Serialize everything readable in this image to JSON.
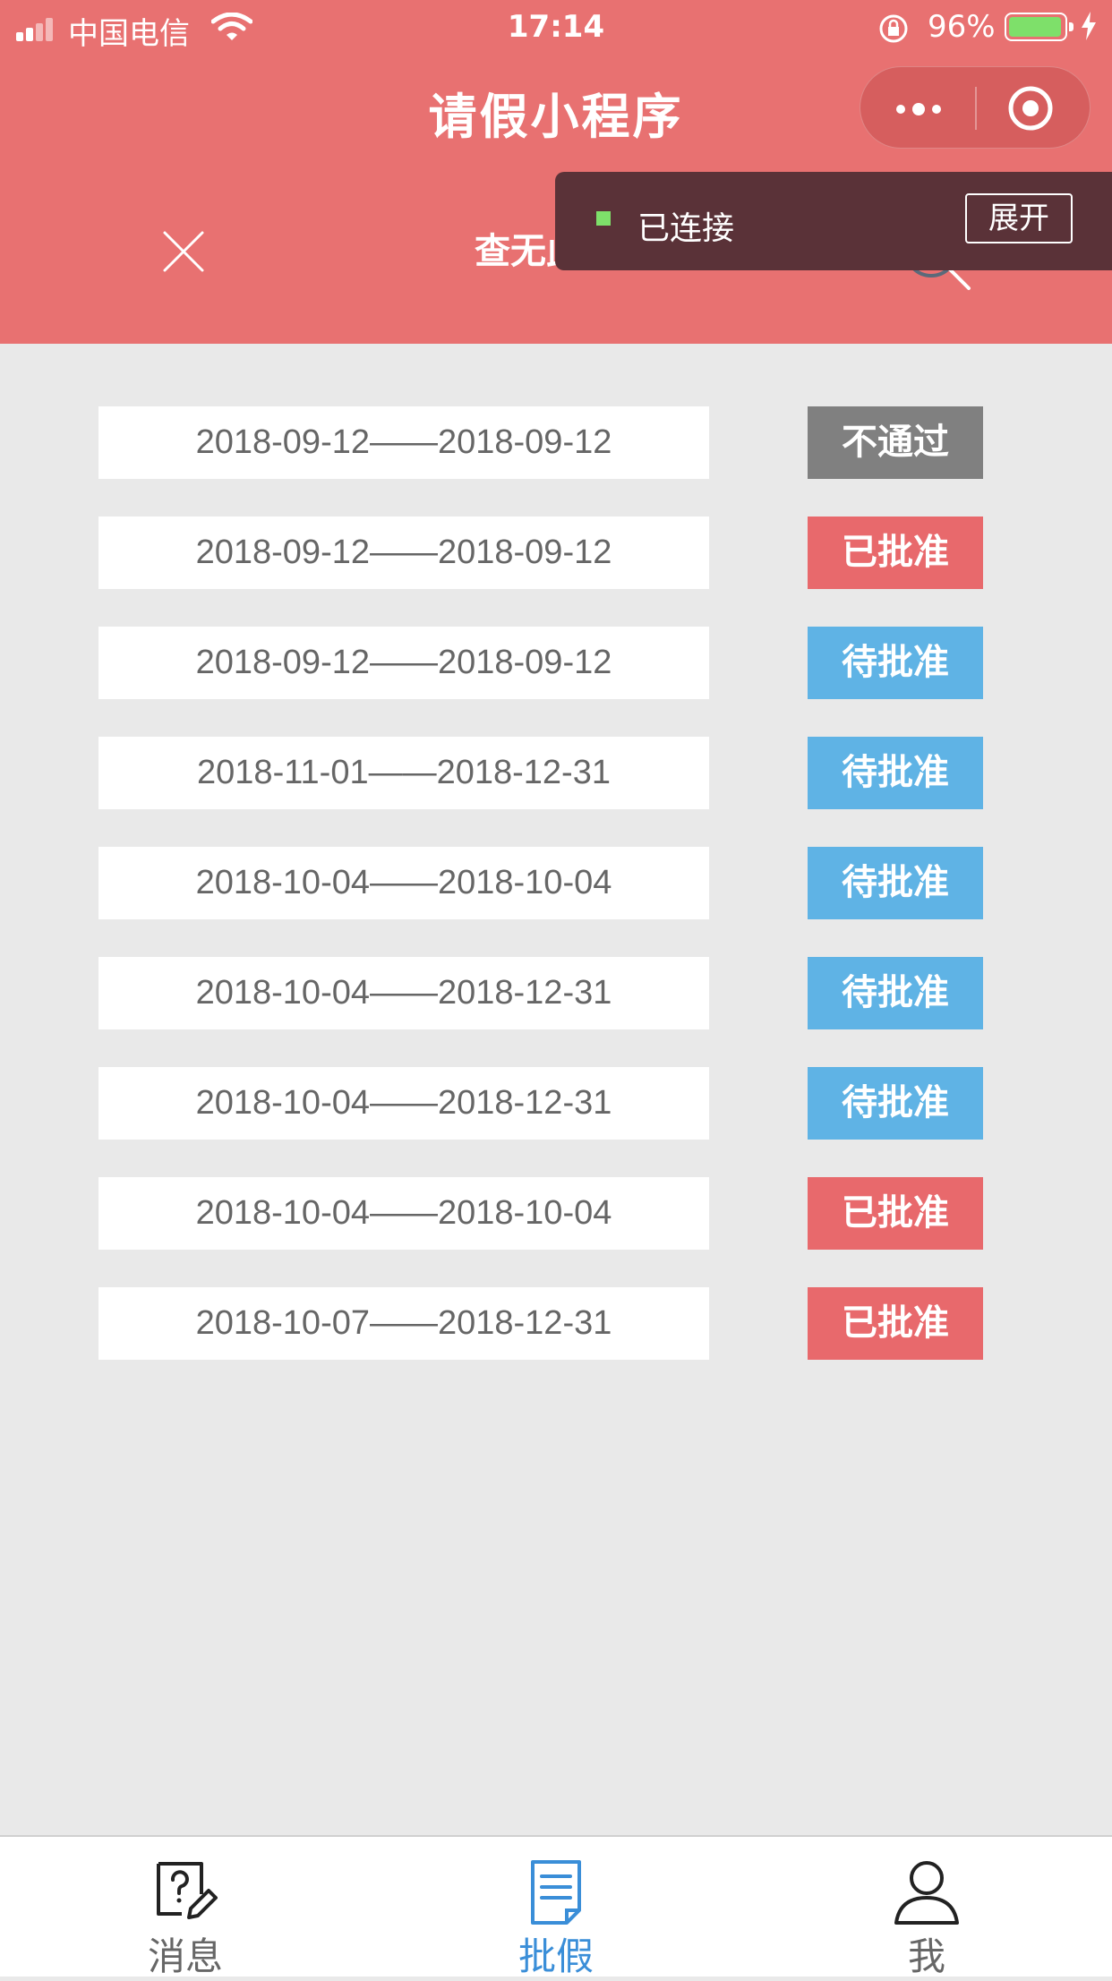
{
  "status_bar": {
    "carrier": "中国电信",
    "time": "17:14",
    "battery_percent": "96%",
    "battery_level": 0.96
  },
  "header": {
    "title": "请假小程序",
    "search_text": "查无此人"
  },
  "debug_banner": {
    "status": "已连接",
    "expand_label": "展开"
  },
  "colors": {
    "header": "#e87171",
    "rejected": "#808080",
    "approved": "#e8696c",
    "pending": "#5fb3e5",
    "active_tab": "#3a8ed8"
  },
  "leaves": [
    {
      "range": "2018-09-12——2018-09-12",
      "status": "不通过",
      "status_type": "rejected"
    },
    {
      "range": "2018-09-12——2018-09-12",
      "status": "已批准",
      "status_type": "approved"
    },
    {
      "range": "2018-09-12——2018-09-12",
      "status": "待批准",
      "status_type": "pending"
    },
    {
      "range": "2018-11-01——2018-12-31",
      "status": "待批准",
      "status_type": "pending"
    },
    {
      "range": "2018-10-04——2018-10-04",
      "status": "待批准",
      "status_type": "pending"
    },
    {
      "range": "2018-10-04——2018-12-31",
      "status": "待批准",
      "status_type": "pending"
    },
    {
      "range": "2018-10-04——2018-12-31",
      "status": "待批准",
      "status_type": "pending"
    },
    {
      "range": "2018-10-04——2018-10-04",
      "status": "已批准",
      "status_type": "approved"
    },
    {
      "range": "2018-10-07——2018-12-31",
      "status": "已批准",
      "status_type": "approved"
    }
  ],
  "tabbar": {
    "tabs": [
      {
        "label": "消息",
        "icon": "question-edit-icon",
        "active": false
      },
      {
        "label": "批假",
        "icon": "document-icon",
        "active": true
      },
      {
        "label": "我",
        "icon": "user-icon",
        "active": false
      }
    ]
  }
}
